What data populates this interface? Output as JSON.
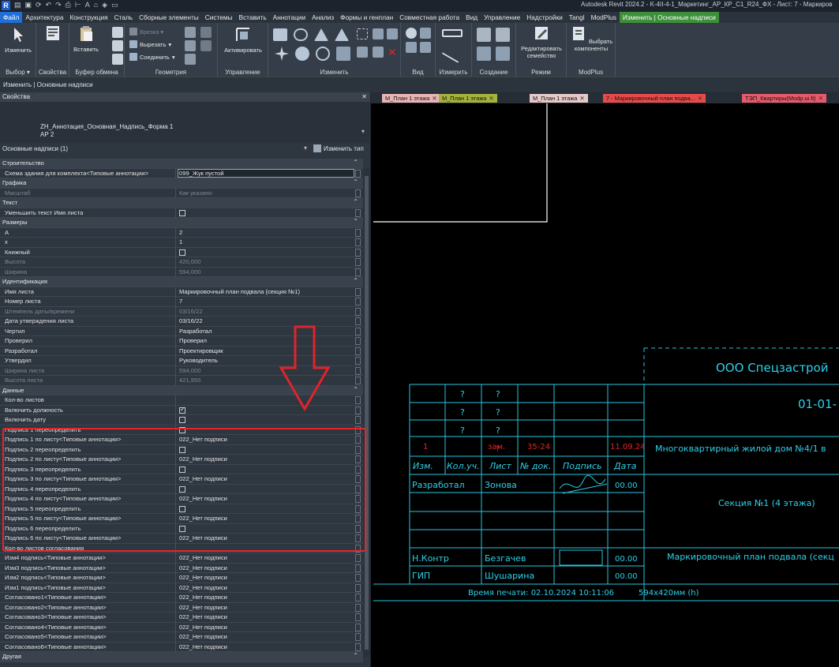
{
  "window": {
    "title": "Autodesk Revit 2024.2 - K-4II-4-1_Маркетинг_АР_КР_С1_R24_ФХ - Лист: 7 - Маркиров",
    "app_logo": "R"
  },
  "menu": [
    "Файл",
    "Архитектура",
    "Конструкция",
    "Сталь",
    "Сборные элементы",
    "Системы",
    "Вставить",
    "Аннотации",
    "Анализ",
    "Формы и генплан",
    "Совместная работа",
    "Вид",
    "Управление",
    "Надстройки",
    "Tangl",
    "ModPlus",
    "Изменить | Основные надписи"
  ],
  "ribbon": {
    "modify_label": "Изменить",
    "paste_label": "Вставить",
    "properties_label": "Свойства",
    "cut_label": "Вырезать",
    "join_label": "Соединить",
    "activate_label": "Активировать",
    "edit_family_label": "Редактировать семейство",
    "pick_components_label": "Выбрать компоненты",
    "panels": [
      "Выбор ▾",
      "Свойства",
      "Буфер обмена",
      "Геометрия",
      "Управление",
      "Изменить",
      "Вид",
      "Измерить",
      "Создание",
      "Режим",
      "ModPlus"
    ]
  },
  "context_bar": "Изменить | Основные надписи",
  "properties": {
    "header": "Свойства",
    "type_name_1": "ZH_Аннотация_Основная_Надпись_Форма 1",
    "type_name_2": "АР 2",
    "instance_filter": "Основные надписи (1)",
    "edit_type": "Изменить тип",
    "rows": [
      {
        "kind": "cat",
        "n": "Строительство"
      },
      {
        "kind": "val",
        "n": "Схема здания для комплекта<Типовые аннотации>",
        "v": "099_Жук пустой",
        "hl": true
      },
      {
        "kind": "cat",
        "n": "Графика"
      },
      {
        "kind": "val",
        "n": "Масштаб",
        "v": "Как указано",
        "dim": true
      },
      {
        "kind": "cat",
        "n": "Текст"
      },
      {
        "kind": "cb",
        "n": "Уменьшить текст Имя листа",
        "on": false
      },
      {
        "kind": "cat",
        "n": "Размеры"
      },
      {
        "kind": "val",
        "n": "А",
        "v": "2"
      },
      {
        "kind": "val",
        "n": "х",
        "v": "1"
      },
      {
        "kind": "cb",
        "n": "Книжный",
        "on": false
      },
      {
        "kind": "val",
        "n": "Высота",
        "v": "420,000",
        "dim": true
      },
      {
        "kind": "val",
        "n": "Ширина",
        "v": "594,000",
        "dim": true
      },
      {
        "kind": "cat",
        "n": "Идентификация"
      },
      {
        "kind": "val",
        "n": "Имя листа",
        "v": "Маркировочный план подвала (секция №1)"
      },
      {
        "kind": "val",
        "n": "Номер листа",
        "v": "7"
      },
      {
        "kind": "val",
        "n": "Штемпель даты/времени",
        "v": "03/16/22",
        "dim": true
      },
      {
        "kind": "val",
        "n": "Дата утверждения листа",
        "v": "03/16/22"
      },
      {
        "kind": "val",
        "n": "Чертил",
        "v": "Разработал"
      },
      {
        "kind": "val",
        "n": "Проверил",
        "v": "Проверил"
      },
      {
        "kind": "val",
        "n": "Разработал",
        "v": "Проектировщик"
      },
      {
        "kind": "val",
        "n": "Утвердил",
        "v": "Руководитель"
      },
      {
        "kind": "val",
        "n": "Ширина листа",
        "v": "594,000",
        "dim": true
      },
      {
        "kind": "val",
        "n": "Высота листа",
        "v": "421,955",
        "dim": true
      },
      {
        "kind": "cat",
        "n": "Данные"
      },
      {
        "kind": "val",
        "n": "Кол-во листов",
        "v": ""
      },
      {
        "kind": "cb",
        "n": "Включить должность",
        "on": true
      },
      {
        "kind": "cb",
        "n": "Включить дату",
        "on": false
      },
      {
        "kind": "cb",
        "n": "Подпись 1 переопределить",
        "on": false
      },
      {
        "kind": "val",
        "n": "Подпись 1 по листу<Типовые аннотации>",
        "v": "022_Нет подписи"
      },
      {
        "kind": "cb",
        "n": "Подпись 2 переопределить",
        "on": false
      },
      {
        "kind": "val",
        "n": "Подпись 2 по листу<Типовые аннотации>",
        "v": "022_Нет подписи"
      },
      {
        "kind": "cb",
        "n": "Подпись 3 переопределить",
        "on": false
      },
      {
        "kind": "val",
        "n": "Подпись 3 по листу<Типовые аннотации>",
        "v": "022_Нет подписи"
      },
      {
        "kind": "cb",
        "n": "Подпись 4 переопределить",
        "on": false
      },
      {
        "kind": "val",
        "n": "Подпись 4 по листу<Типовые аннотации>",
        "v": "022_Нет подписи"
      },
      {
        "kind": "cb",
        "n": "Подпись 5 переопределить",
        "on": false
      },
      {
        "kind": "val",
        "n": "Подпись 5 по листу<Типовые аннотации>",
        "v": "022_Нет подписи"
      },
      {
        "kind": "cb",
        "n": "Подпись 6 переопределить",
        "on": false
      },
      {
        "kind": "val",
        "n": "Подпись 6 по листу<Типовые аннотации>",
        "v": "022_Нет подписи"
      },
      {
        "kind": "val",
        "n": "Кол-во листов согласования",
        "v": ""
      },
      {
        "kind": "val",
        "n": "Изм4 подпись<Типовые аннотации>",
        "v": "022_Нет подписи"
      },
      {
        "kind": "val",
        "n": "Изм3 подпись<Типовые аннотации>",
        "v": "022_Нет подписи"
      },
      {
        "kind": "val",
        "n": "Изм2 подпись<Типовые аннотации>",
        "v": "022_Нет подписи"
      },
      {
        "kind": "val",
        "n": "Изм1 подпись<Типовые аннотации>",
        "v": "022_Нет подписи"
      },
      {
        "kind": "val",
        "n": "Согласовано1<Типовые аннотации>",
        "v": "022_Нет подписи"
      },
      {
        "kind": "val",
        "n": "Согласовано2<Типовые аннотации>",
        "v": "022_Нет подписи"
      },
      {
        "kind": "val",
        "n": "Согласовано3<Типовые аннотации>",
        "v": "022_Нет подписи"
      },
      {
        "kind": "val",
        "n": "Согласовано4<Типовые аннотации>",
        "v": "022_Нет подписи"
      },
      {
        "kind": "val",
        "n": "Согласовано5<Типовые аннотации>",
        "v": "022_Нет подписи"
      },
      {
        "kind": "val",
        "n": "Согласовано6<Типовые аннотации>",
        "v": "022_Нет подписи"
      },
      {
        "kind": "cat",
        "n": "Другая"
      }
    ]
  },
  "view_tabs": [
    {
      "label": "М_План 1 этажа",
      "color": "#e8b4b4"
    },
    {
      "label": "М_План 1 этажа",
      "color": "#a6b33a"
    },
    {
      "label": "М_План 1 этажа",
      "color": "#e6c9c9"
    },
    {
      "label": "7 - Маркировочный план подва...",
      "color": "#e84a4a"
    },
    {
      "label": "ТЭП_Квартиры(Modp.ui.ft)",
      "color": "#e85a6a"
    }
  ],
  "stamp": {
    "company": "ООО Спецзастрой",
    "code": "01-01-",
    "project": "Многоквартирный жилой дом №4/1 в",
    "section": "Секция №1 (4 этажа)",
    "sheet_title": "Маркировочный план подвала (секц",
    "q": "?",
    "rev_row": [
      "1",
      "зам.",
      "?",
      "35-24",
      "",
      "11.09.24"
    ],
    "headers": [
      "Изм.",
      "Кол.уч.",
      "Лист",
      "№ док.",
      "Подпись",
      "Дата"
    ],
    "developed_label": "Разработал",
    "developed_name": "Зонова",
    "developed_date": "00.00",
    "nkontr_label": "Н.Контр",
    "nkontr_name": "Безгачев",
    "nkontr_date": "00.00",
    "gip_label": "ГИП",
    "gip_name": "Шушарина",
    "gip_date": "00.00",
    "print_time": "Время печати: 02.10.2024  10:11:06",
    "format": "594x420мм (h)"
  },
  "colors": {
    "stamp_line": "#26c6e0",
    "stamp_text": "#2fd0e8",
    "stamp_red": "#e0242b",
    "arrow": "#e0242b",
    "white": "#ffffff"
  }
}
